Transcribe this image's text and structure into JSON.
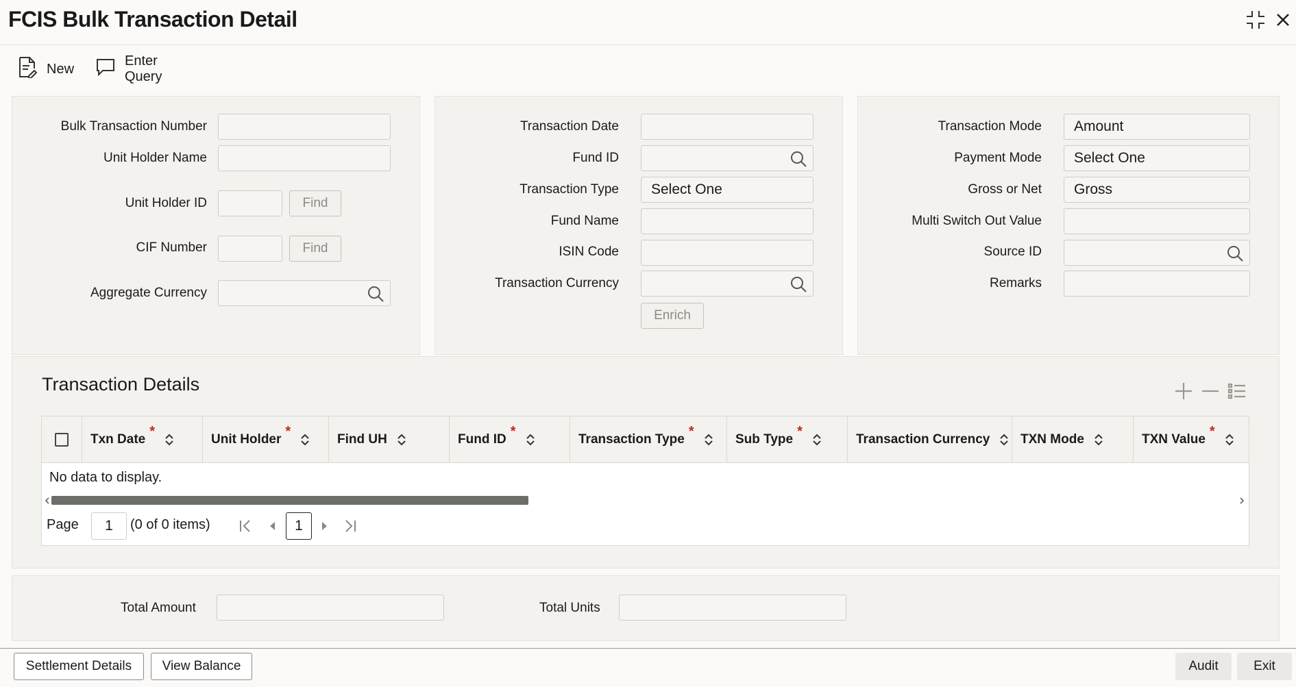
{
  "window": {
    "title": "FCIS Bulk Transaction Detail"
  },
  "toolbar": {
    "new_label": "New",
    "enter_query_label": "Enter Query"
  },
  "left_panel": {
    "bulk_txn_number_label": "Bulk Transaction Number",
    "unit_holder_name_label": "Unit Holder Name",
    "unit_holder_id_label": "Unit Holder ID",
    "cif_number_label": "CIF Number",
    "aggregate_currency_label": "Aggregate Currency",
    "find_label": "Find"
  },
  "middle_panel": {
    "transaction_date_label": "Transaction Date",
    "fund_id_label": "Fund ID",
    "transaction_type_label": "Transaction Type",
    "transaction_type_value": "Select One",
    "fund_name_label": "Fund Name",
    "isin_code_label": "ISIN Code",
    "transaction_currency_label": "Transaction Currency",
    "enrich_label": "Enrich"
  },
  "right_panel": {
    "transaction_mode_label": "Transaction Mode",
    "transaction_mode_value": "Amount",
    "payment_mode_label": "Payment Mode",
    "payment_mode_value": "Select One",
    "gross_or_net_label": "Gross or Net",
    "gross_or_net_value": "Gross",
    "multi_switch_out_label": "Multi Switch Out Value",
    "source_id_label": "Source ID",
    "remarks_label": "Remarks"
  },
  "transaction_details": {
    "title": "Transaction Details",
    "columns": [
      {
        "label": "Txn Date",
        "required": "*"
      },
      {
        "label": "Unit Holder",
        "required": "*"
      },
      {
        "label": "Find UH",
        "required": ""
      },
      {
        "label": "Fund ID",
        "required": "*"
      },
      {
        "label": "Transaction Type",
        "required": "*"
      },
      {
        "label": "Sub Type",
        "required": "*"
      },
      {
        "label": "Transaction Currency",
        "required": ""
      },
      {
        "label": "TXN Mode",
        "required": ""
      },
      {
        "label": "TXN Value",
        "required": "*"
      }
    ],
    "empty_text": "No data to display.",
    "page_label": "Page",
    "page_value": "1",
    "items_text": "(0 of 0 items)",
    "current_page": "1"
  },
  "totals": {
    "total_amount_label": "Total Amount",
    "total_units_label": "Total Units"
  },
  "footer": {
    "settlement_details_label": "Settlement Details",
    "view_balance_label": "View Balance",
    "audit_label": "Audit",
    "exit_label": "Exit"
  },
  "colors": {
    "required": "#c4261d",
    "panel_bg": "#f4f2ef",
    "scrollbar": "#6f6d6a"
  }
}
